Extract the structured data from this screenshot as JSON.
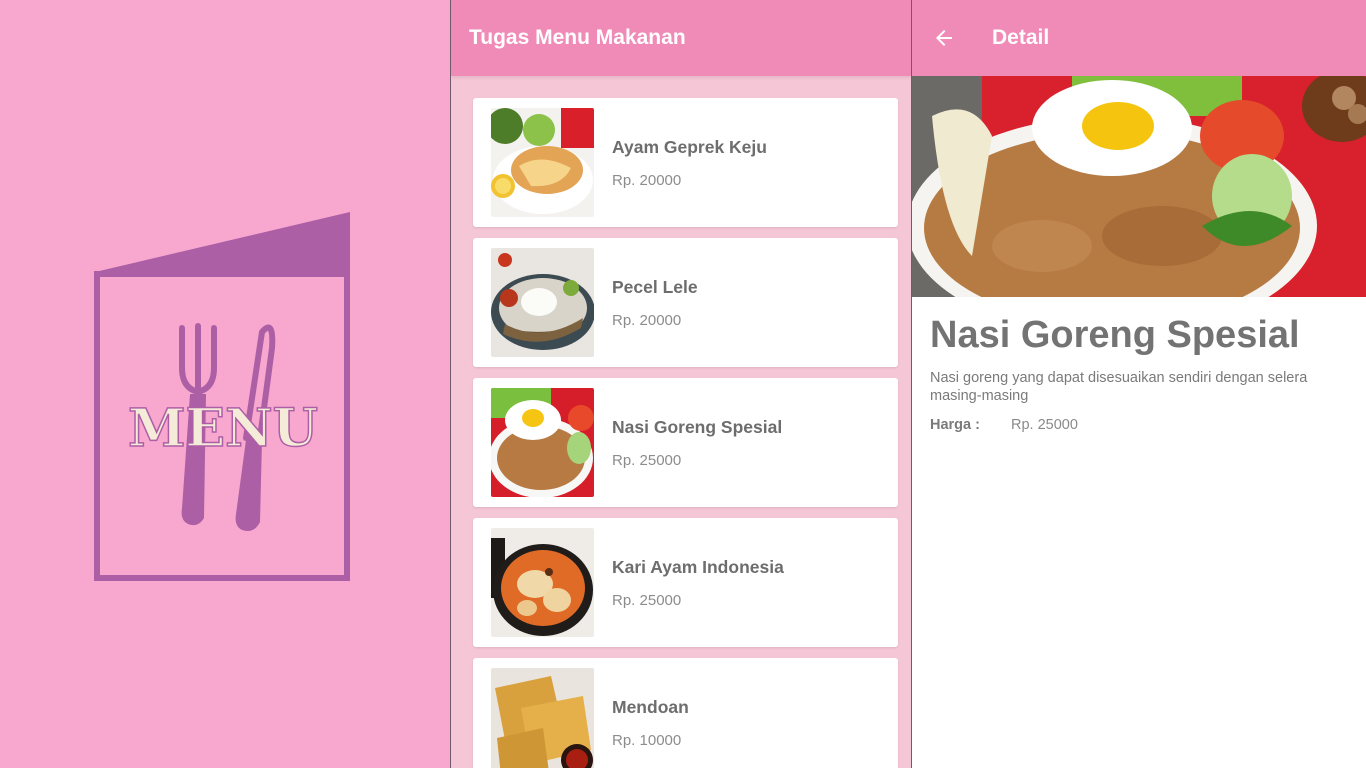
{
  "splash": {
    "logo_text": "MENU",
    "colors": {
      "background": "#f8a8cf",
      "logo": "#ad5fa6",
      "logo_text": "#f4ecd8"
    }
  },
  "list_screen": {
    "title": "Tugas Menu Makanan",
    "items": [
      {
        "name": "Ayam Geprek Keju",
        "price": "Rp. 20000",
        "image": "ayam-geprek-keju-image"
      },
      {
        "name": "Pecel Lele",
        "price": "Rp. 20000",
        "image": "pecel-lele-image"
      },
      {
        "name": "Nasi Goreng Spesial",
        "price": "Rp. 25000",
        "image": "nasi-goreng-spesial-image"
      },
      {
        "name": "Kari Ayam Indonesia",
        "price": "Rp. 25000",
        "image": "kari-ayam-indonesia-image"
      },
      {
        "name": "Mendoan",
        "price": "Rp. 10000",
        "image": "mendoan-image"
      }
    ]
  },
  "detail_screen": {
    "title": "Detail",
    "back_icon": "arrow-left-icon",
    "name": "Nasi Goreng Spesial",
    "description": "Nasi goreng yang dapat disesuaikan sendiri dengan selera masing-masing",
    "price_label": "Harga :",
    "price": "Rp. 25000"
  },
  "colors": {
    "appbar": "#f08bb8",
    "list_background": "#f5c6d6",
    "card": "#ffffff",
    "text_primary": "#6d6d6d",
    "text_secondary": "#8c8c8c"
  }
}
